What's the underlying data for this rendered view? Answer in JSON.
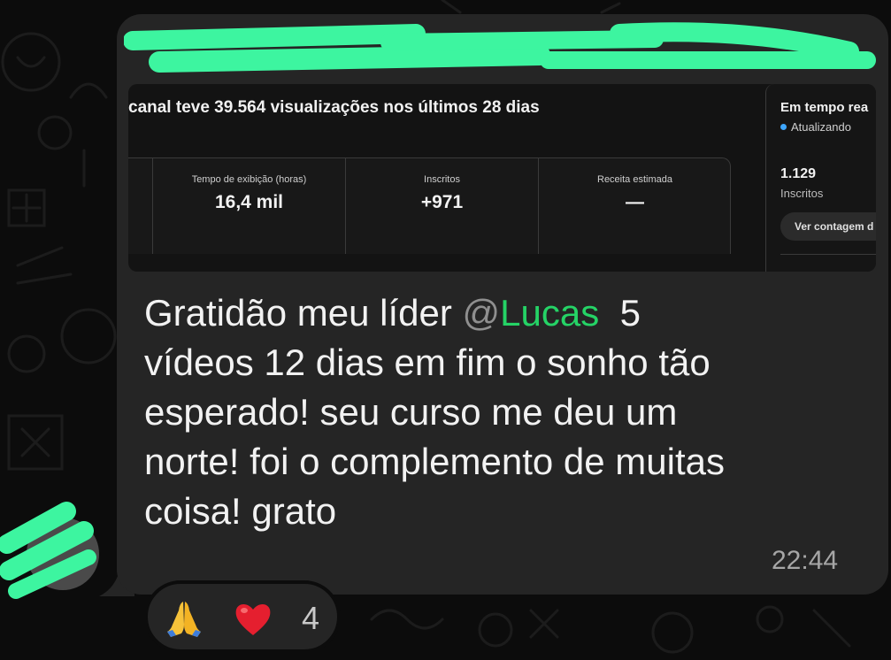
{
  "shared_screenshot": {
    "headline": "canal teve 39.564 visualizações nos últimos 28 dias",
    "metrics": [
      {
        "label": "Tempo de exibição (horas)",
        "value": "16,4 mil"
      },
      {
        "label": "Inscritos",
        "value": "+971"
      },
      {
        "label": "Receita estimada",
        "value": "—"
      }
    ],
    "realtime": {
      "title": "Em tempo rea",
      "status": "Atualizando",
      "subscriber_count": "1.129",
      "subscriber_label": "Inscritos",
      "button_label": "Ver contagem d"
    }
  },
  "message": {
    "line1_before": "Gratidão meu líder ",
    "mention_at": "@",
    "mention_name": "Lucas",
    "line1_after": "  5",
    "lines": [
      "vídeos 12 dias em fim o sonho tão",
      "esperado! seu curso me deu um",
      "norte! foi o complemento de muitas",
      "coisa! grato"
    ],
    "time": "22:44"
  },
  "reactions": {
    "emojis": [
      "folded-hands",
      "red-heart"
    ],
    "count": "4"
  },
  "colors": {
    "bubble": "#252525",
    "mention": "#25d366",
    "redaction": "#3df5a0",
    "background": "#0c0c0c"
  }
}
